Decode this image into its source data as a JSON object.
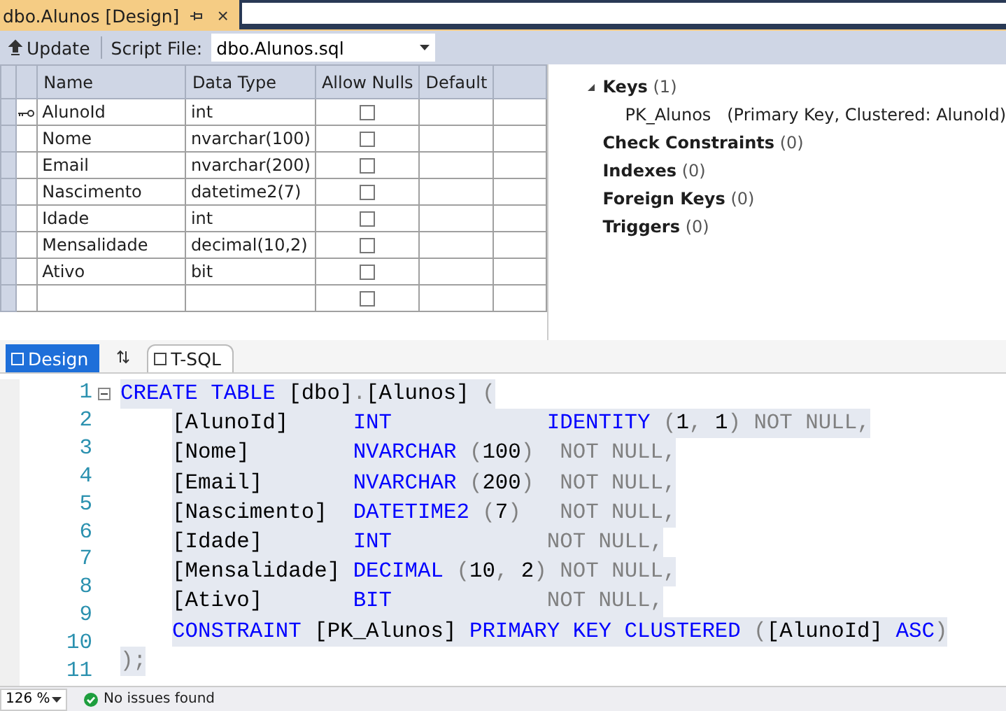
{
  "document_tab": {
    "title": "dbo.Alunos [Design]",
    "close": "×"
  },
  "toolbar": {
    "update": "Update",
    "script_file_label": "Script File:",
    "script_file": "dbo.Alunos.sql"
  },
  "grid": {
    "columns": [
      "Name",
      "Data Type",
      "Allow Nulls",
      "Default"
    ],
    "rows": [
      {
        "name": "AlunoId",
        "type": "int",
        "allow_nulls": false,
        "primary_key": true
      },
      {
        "name": "Nome",
        "type": "nvarchar(100)",
        "allow_nulls": false,
        "primary_key": false
      },
      {
        "name": "Email",
        "type": "nvarchar(200)",
        "allow_nulls": false,
        "primary_key": false
      },
      {
        "name": "Nascimento",
        "type": "datetime2(7)",
        "allow_nulls": false,
        "primary_key": false
      },
      {
        "name": "Idade",
        "type": "int",
        "allow_nulls": false,
        "primary_key": false
      },
      {
        "name": "Mensalidade",
        "type": "decimal(10,2)",
        "allow_nulls": false,
        "primary_key": false
      },
      {
        "name": "Ativo",
        "type": "bit",
        "allow_nulls": false,
        "primary_key": false
      },
      {
        "allow_nulls": false,
        "primary_key": false
      }
    ]
  },
  "properties": [
    {
      "label": "Keys",
      "count": "(1)",
      "expanded": true,
      "children": [
        {
          "name": "PK_Alunos",
          "detail": "(Primary Key, Clustered: AlunoId)"
        }
      ]
    },
    {
      "label": "Check Constraints",
      "count": "(0)"
    },
    {
      "label": "Indexes",
      "count": "(0)"
    },
    {
      "label": "Foreign Keys",
      "count": "(0)"
    },
    {
      "label": "Triggers",
      "count": "(0)"
    }
  ],
  "pane_tabs": [
    {
      "label": "Design",
      "selected": true
    },
    {
      "label": "T-SQL",
      "selected": false
    }
  ],
  "editor": {
    "lines": [
      {
        "number": "1",
        "selected": true,
        "tokens": [
          {
            "kind": "keyword",
            "text": "CREATE TABLE "
          },
          {
            "kind": "plain",
            "text": "[dbo]"
          },
          {
            "kind": "gray",
            "text": "."
          },
          {
            "kind": "plain",
            "text": "[Alunos] "
          },
          {
            "kind": "gray",
            "text": "("
          }
        ]
      },
      {
        "number": "2",
        "selected": true,
        "tokens": [
          {
            "kind": "plain",
            "text": "[AlunoId]     "
          },
          {
            "kind": "keyword",
            "text": "INT            IDENTITY "
          },
          {
            "kind": "gray",
            "text": "("
          },
          {
            "kind": "plain",
            "text": "1"
          },
          {
            "kind": "gray",
            "text": ", "
          },
          {
            "kind": "plain",
            "text": "1"
          },
          {
            "kind": "gray",
            "text": ") NOT NULL,"
          }
        ]
      },
      {
        "number": "3",
        "selected": true,
        "tokens": [
          {
            "kind": "plain",
            "text": "[Nome]        "
          },
          {
            "kind": "keyword",
            "text": "NVARCHAR "
          },
          {
            "kind": "gray",
            "text": "("
          },
          {
            "kind": "plain",
            "text": "100"
          },
          {
            "kind": "gray",
            "text": ")  NOT NULL,"
          }
        ]
      },
      {
        "number": "4",
        "selected": true,
        "tokens": [
          {
            "kind": "plain",
            "text": "[Email]       "
          },
          {
            "kind": "keyword",
            "text": "NVARCHAR "
          },
          {
            "kind": "gray",
            "text": "("
          },
          {
            "kind": "plain",
            "text": "200"
          },
          {
            "kind": "gray",
            "text": ")  NOT NULL,"
          }
        ]
      },
      {
        "number": "5",
        "selected": true,
        "tokens": [
          {
            "kind": "plain",
            "text": "[Nascimento]  "
          },
          {
            "kind": "keyword",
            "text": "DATETIME2 "
          },
          {
            "kind": "gray",
            "text": "("
          },
          {
            "kind": "plain",
            "text": "7"
          },
          {
            "kind": "gray",
            "text": ")   NOT NULL,"
          }
        ]
      },
      {
        "number": "6",
        "selected": true,
        "tokens": [
          {
            "kind": "plain",
            "text": "[Idade]       "
          },
          {
            "kind": "keyword",
            "text": "INT            "
          },
          {
            "kind": "gray",
            "text": "NOT NULL,"
          }
        ]
      },
      {
        "number": "7",
        "selected": true,
        "tokens": [
          {
            "kind": "plain",
            "text": "[Mensalidade] "
          },
          {
            "kind": "keyword",
            "text": "DECIMAL "
          },
          {
            "kind": "gray",
            "text": "("
          },
          {
            "kind": "plain",
            "text": "10"
          },
          {
            "kind": "gray",
            "text": ", "
          },
          {
            "kind": "plain",
            "text": "2"
          },
          {
            "kind": "gray",
            "text": ") NOT NULL,"
          }
        ]
      },
      {
        "number": "8",
        "selected": true,
        "tokens": [
          {
            "kind": "plain",
            "text": "[Ativo]       "
          },
          {
            "kind": "keyword",
            "text": "BIT            "
          },
          {
            "kind": "gray",
            "text": "NOT NULL,"
          }
        ]
      },
      {
        "number": "9",
        "selected": true,
        "tokens": [
          {
            "kind": "keyword",
            "text": "CONSTRAINT "
          },
          {
            "kind": "plain",
            "text": "[PK_Alunos] "
          },
          {
            "kind": "keyword",
            "text": "PRIMARY KEY CLUSTERED "
          },
          {
            "kind": "gray",
            "text": "("
          },
          {
            "kind": "plain",
            "text": "[AlunoId] "
          },
          {
            "kind": "keyword",
            "text": "ASC"
          },
          {
            "kind": "gray",
            "text": ")"
          }
        ]
      },
      {
        "number": "10",
        "selected": true,
        "tokens": [
          {
            "kind": "gray",
            "text": ");"
          }
        ]
      },
      {
        "number": "11"
      }
    ]
  },
  "status_bar": {
    "zoom": "126 %",
    "issues": "No issues found"
  }
}
